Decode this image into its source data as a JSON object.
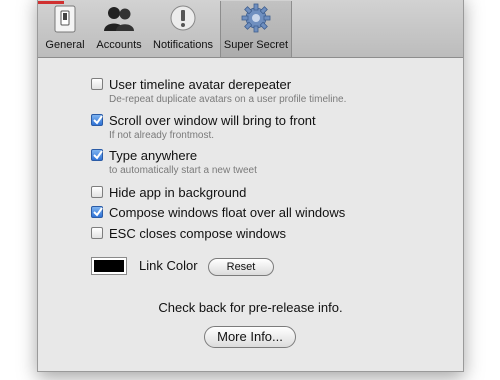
{
  "toolbar": {
    "tabs": [
      {
        "label": "General",
        "icon": "general-switch-icon"
      },
      {
        "label": "Accounts",
        "icon": "accounts-people-icon"
      },
      {
        "label": "Notifications",
        "icon": "notifications-exclamation-icon"
      },
      {
        "label": "Super Secret",
        "icon": "gear-icon"
      }
    ],
    "selected_tab": "Super Secret"
  },
  "options": [
    {
      "label": "User timeline avatar derepeater",
      "sub": "De-repeat duplicate avatars on a user profile timeline.",
      "checked": false
    },
    {
      "label": "Scroll over window will bring to front",
      "sub": "If not already frontmost.",
      "checked": true
    },
    {
      "label": "Type anywhere",
      "sub": "to automatically start a new tweet",
      "checked": true
    },
    {
      "label": "Hide app in background",
      "checked": false
    },
    {
      "label": "Compose windows float over all windows",
      "checked": true
    },
    {
      "label": "ESC closes compose windows",
      "checked": false
    }
  ],
  "link_color": {
    "label": "Link Color",
    "value": "#000000",
    "reset_label": "Reset"
  },
  "info_text": "Check back for pre-release info.",
  "more_info_label": "More Info...",
  "colors": {
    "checkbox_checked": "#2f72d6",
    "window_bg": "#e8e8e8"
  }
}
